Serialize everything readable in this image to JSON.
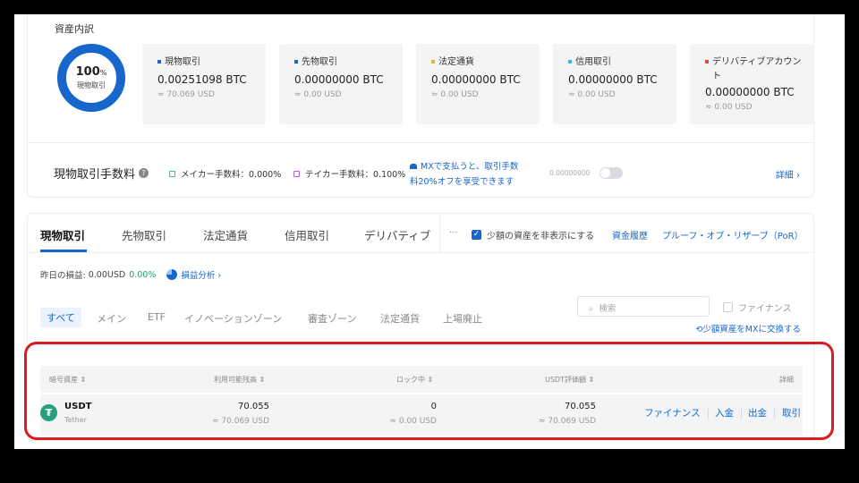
{
  "overview": {
    "title": "資産内訳",
    "donut": {
      "percent": "100",
      "percent_unit": "%",
      "label": "現物取引",
      "color": "#1766cc"
    },
    "cards": [
      {
        "name": "現物取引",
        "amount": "0.00251098 BTC",
        "usd": "≈ 70.069 USD",
        "color": "#1766cc"
      },
      {
        "name": "先物取引",
        "amount": "0.00000000 BTC",
        "usd": "≈ 0.00 USD",
        "color": "#1766cc"
      },
      {
        "name": "法定通貨",
        "amount": "0.00000000 BTC",
        "usd": "≈ 0.00 USD",
        "color": "#f0a93b"
      },
      {
        "name": "信用取引",
        "amount": "0.00000000 BTC",
        "usd": "≈ 0.00 USD",
        "color": "#35b8e0"
      },
      {
        "name": "デリバティブアカウント",
        "amount": "0.00000000 BTC",
        "usd": "≈ 0.00 USD",
        "color": "#e14a4a"
      }
    ]
  },
  "fees": {
    "title": "現物取引手数料",
    "maker": "メイカー手数料：0.000%",
    "taker": "テイカー手数料：0.100%",
    "mx_line1": "MXで支払うと、取引手数",
    "mx_line2": "料20%オフを享受できます",
    "mx_balance": "0.00000000",
    "details": "詳細 ›"
  },
  "tabs": [
    "現物取引",
    "先物取引",
    "法定通貨",
    "信用取引",
    "デリバティブ"
  ],
  "toolbar": {
    "hide_small": "少額の資産を非表示にする",
    "history": "資金履歴",
    "por": "プルーフ・オブ・リザーブ（PoR）"
  },
  "pnl": {
    "label": "昨日の損益:",
    "value": "0.00USD",
    "percent": "0.00%",
    "analysis": "損益分析 ›"
  },
  "filters": [
    "すべて",
    "メイン",
    "ETF",
    "イノベーションゾーン",
    "審査ゾーン",
    "法定通貨",
    "上場廃止"
  ],
  "search": {
    "placeholder": "検索"
  },
  "finance_filter": "ファイナンス",
  "swap_link": "少額資産をMXに交換する",
  "table": {
    "headers": [
      "暗号資産 ⇕",
      "利用可能残高 ⇕",
      "ロック中 ⇕",
      "USDT評価額 ⇕",
      "詳細"
    ],
    "rows": [
      {
        "symbol": "USDT",
        "name": "Tether",
        "available": "70.055",
        "available_usd": "≈ 70.069 USD",
        "locked": "0",
        "locked_usd": "≈ 0.00 USD",
        "usdt_value": "70.055",
        "usdt_value_usd": "≈ 70.069 USD",
        "actions": [
          "ファイナンス",
          "入金",
          "出金",
          "取引"
        ]
      }
    ]
  }
}
